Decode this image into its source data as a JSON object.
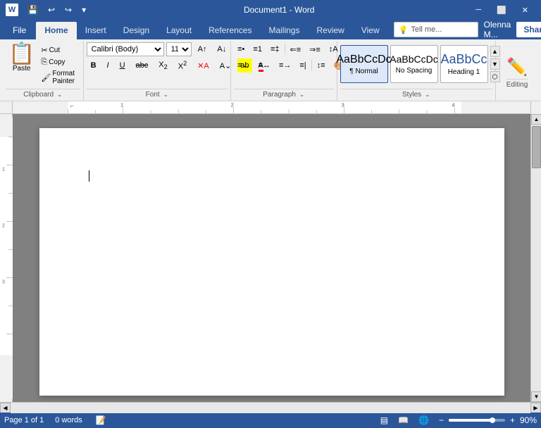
{
  "titleBar": {
    "title": "Document1 - Word",
    "quickAccess": [
      "💾",
      "↩",
      "↪",
      "▾"
    ]
  },
  "tabs": [
    "File",
    "Home",
    "Insert",
    "Design",
    "Layout",
    "References",
    "Mailings",
    "Review",
    "View"
  ],
  "activeTab": "Home",
  "ribbon": {
    "clipboard": {
      "paste": "Paste",
      "cut": "✂",
      "copy": "⎘",
      "formatPainter": "🖌",
      "label": "Clipboard"
    },
    "font": {
      "name": "Calibri (Body)",
      "size": "11",
      "bold": "B",
      "italic": "I",
      "underline": "U",
      "strikethrough": "abc",
      "subscript": "X₂",
      "superscript": "X²",
      "clearFormat": "A",
      "textColor": "A",
      "highlight": "ab",
      "fontColor": "A",
      "growFont": "A",
      "shrinkFont": "A",
      "label": "Font"
    },
    "paragraph": {
      "label": "Paragraph"
    },
    "styles": {
      "items": [
        {
          "name": "Normal",
          "preview": "AaBbCcDc",
          "label": "¶ Normal",
          "active": true
        },
        {
          "name": "NoSpacing",
          "preview": "AaBbCcDc",
          "label": "No Spacing",
          "active": false
        },
        {
          "name": "Heading1",
          "preview": "AaBbCc",
          "label": "Heading 1",
          "active": false
        }
      ],
      "label": "Styles"
    },
    "editing": {
      "label": "Editing"
    }
  },
  "tellMe": {
    "placeholder": "Tell me...",
    "icon": "💡"
  },
  "user": {
    "name": "Olenna M...",
    "shareLabel": "Share"
  },
  "document": {
    "content": ""
  },
  "statusBar": {
    "page": "Page 1 of 1",
    "words": "0 words",
    "language": "🔤",
    "zoom": "90%",
    "viewNormal": "▤",
    "viewRead": "📖",
    "viewWeb": "🌐"
  },
  "windowControls": {
    "minimize": "─",
    "restore": "⬜",
    "close": "✕",
    "ribbonMin": "─",
    "ribbonRestore": "⬜",
    "ribbonClose": "✕"
  }
}
